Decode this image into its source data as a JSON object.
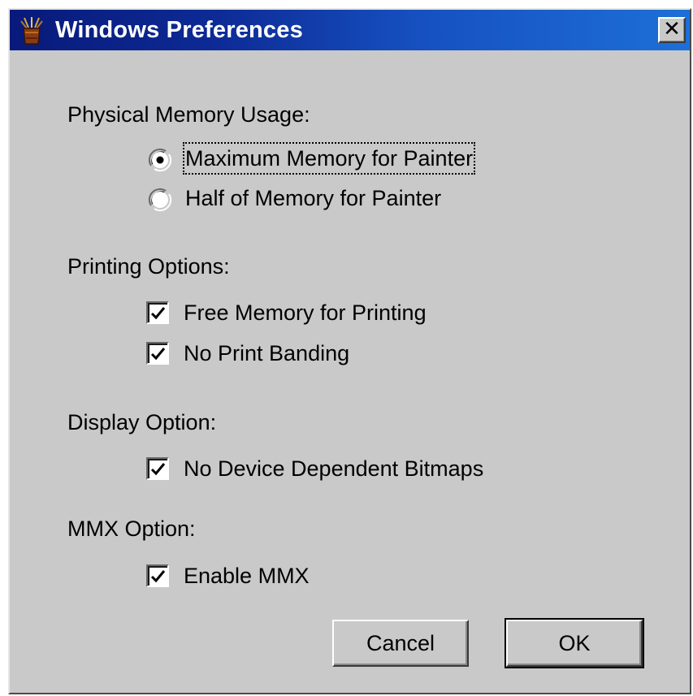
{
  "window": {
    "title": "Windows Preferences",
    "app_icon": "painter-brush-pot-icon",
    "close_glyph": "✕"
  },
  "sections": {
    "physical_memory": {
      "label": "Physical Memory Usage:",
      "options": [
        {
          "label": "Maximum Memory for Painter",
          "selected": true
        },
        {
          "label": "Half of Memory for Painter",
          "selected": false
        }
      ]
    },
    "printing": {
      "label": "Printing Options:",
      "options": [
        {
          "label": "Free Memory for Printing",
          "checked": true
        },
        {
          "label": "No Print Banding",
          "checked": true
        }
      ]
    },
    "display": {
      "label": "Display Option:",
      "options": [
        {
          "label": "No Device Dependent Bitmaps",
          "checked": true
        }
      ]
    },
    "mmx": {
      "label": "MMX Option:",
      "options": [
        {
          "label": "Enable MMX",
          "checked": true
        }
      ]
    }
  },
  "buttons": {
    "cancel": "Cancel",
    "ok": "OK"
  },
  "colors": {
    "title_start": "#081a7a",
    "title_end": "#1d6fd8",
    "dialog_face": "#c9c9c9"
  }
}
